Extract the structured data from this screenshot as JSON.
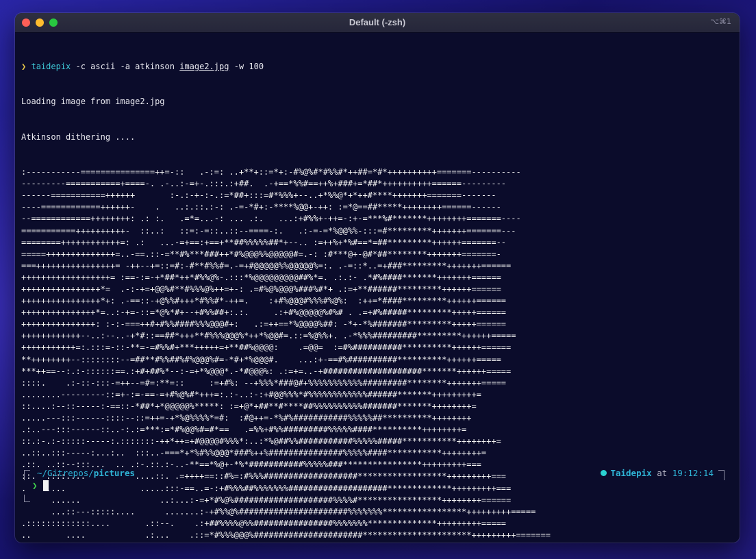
{
  "window": {
    "title": "Default (-zsh)",
    "shortcut": "⌥⌘1"
  },
  "terminal": {
    "command": {
      "arrow": "❯",
      "program": "taidepix",
      "args_before": " -c ascii -a atkinson ",
      "file": "image2.jpg",
      "args_after": " -w 100"
    },
    "output_lines": [
      "Loading image from image2.jpg",
      "Atkinson dithering ...."
    ],
    "ascii_art": ":-----------===============++=-::   .-:=: ..+**+::=*+:-#%@%#*#%%#*++##=*#*++++++++++=======----------\n---------===========+====-. .-..:-=+-.:::.:+##.  .-+==*%%#==++%+###+=*##*++++++++++======---------\n------===========++++++       :-.:-+-:-.:=*##+:::=#*%%%+--..+*%%@*+*++#****+++++++=======-------\n----============++++++-    .   ..:.::.:-: .-=-*#+:-****%@@+-++: :=*@==##*****++++++++======------\n--============++++++++: .: :.   .=*=...-: ... .:.   ...:+#%%+-++=-:+-=***%#*******++++++++=======----\n===========++++++++++-  ::..:   ::=:-=::..::--====-:.   .:-=-=*%@@%%-:::=#*********+++++++=======---\n========++++++++++++=: .:   ...-=+==:+==+**##%%%%%##*+--.. :=++%+*%#==*=##*********++++++=======--\n=====++++++++++++++=..-==.::-=**#%***###++*#%@@@%%@@@@@#=.-: :#***@+-@#*##********+++++++=======-\n===++++++++++++++++= -++--+=::=#:-#**#%%#=.-=+#@@@@@%%@@@@@%=:. .-=::*..=+###*********+++++++======\n++++++++++++++++++= :==-:=-+*##*++*#%%@%-.:::*%@@@@@@@@@##%*=. .:.:- .*#%####*******+++++++======\n++++++++++++++++*=  .-:-+=+@@%#**#%%%@%++=+-: .=#%@%@@@%###%#*+ .:=+**######*********++++++======\n++++++++++++++++*+: .-==::-+@%%#+++*#%%#*-++=.    :+#%@@@#%%%#%@%:  :++=*####*********++++++======\n+++++++++++++++*=..:-+=-::=*@%*#+--+#%%##+:.:.     .:+#%@@@@@%#%# . .=+#%#####*********+++++======\n+++++++++++++++: :-:-===++#+#%%####%%%@@@#+:   .:=++==*%@@@@%##: -*+-*%#######*********+++++======\n++++++++++++--..:--..-+*#::==##*+++**#%%%@@@%*++*%@@#=.::=%@%%+. .-*%%%#########*********++++++=====\n+++++++++++=:.:::=-::-**=-=#%%#+***+++++=+**##%@@@@:    .=@@=  :=#%##########**********++++++======\n**++++++++--::::::::--=##**#%%##%#%@@@%#=-*#+*%@@@#.    ...:+-==#%##########**********++++++=====\n***++==--:.:-::::::==.:+#+##%*--:-=+*%@@@*.-*#@@@%: .:=+=..-+####################*******++++++=====\n::::.    .:-::-:::-=++--=#=:**=::     :=+#%: --+%%%*###@#+%%%%%%%%%%%#########********+++++++=====\n........---------::=+-:=-==-=+#%@%#*+++=:.:-..:-:+#@@%%%*#%%%%%%%%%%%%######*******+++++++++=\n::....:--::-----:-==::-*##*+*@@@@@%*****: :=+@*+##**#****##%%%%%%%%%%#######*******++++++++=\n.....---:::------::::--::=++=-+*%@%%%%*=#:  :#@++=-*%#%###########%%%%%##**********++++++++\n.:..---:::------::..-:.:=***:=*#%@@%#=#*==   .=%%+#%%#########%%%%%####**********++++++++=\n::.:-.:-:::::-----:.:::::::-++*++=+#@@@@#%%%*:..:*%@##%%###########%%%%%#####***********++++++++=\n..::..:::-----:...:..  :::..-===*+*%#%%@@@*###%++%###############%%%%%####***********++++++++=\n.::. ..::--:::...  .. .:-.::.:-..-**==*%@+-*%*###########%%%%%###****************+++++++++===\n::.  .:::....          ....::. .=++++==::#%=:#%%%###################******************+++++++++===\n.    ....               .....:::-==..=-:+#%%%##%%%%%%%####################*************+++++++++===\n      ......                ..:...:-=+*#%@%####################%%%%#*****************++++++++======\n      ...::---:::::....      .......:-+#%%@%######################%%%%%%%*****************+++++++++=====\n.:::::::::::::....       .::--.    .:+##%%%%@%%################%%%%%%%**************+++++++++=====\n..       ....            .:...    .::=*#%%%@@@%######################**********************+++++++++=======\n**+:..::::::::::::::------::----===++##%%%@@@%*####**************************+++++++++++++=======--"
  },
  "prompt": {
    "path_prefix": "~/Gitrepos/",
    "path_current": "pictures",
    "user": "Taidepix",
    "at": " at ",
    "time": "19:12:14",
    "input_arrow": "❯"
  }
}
